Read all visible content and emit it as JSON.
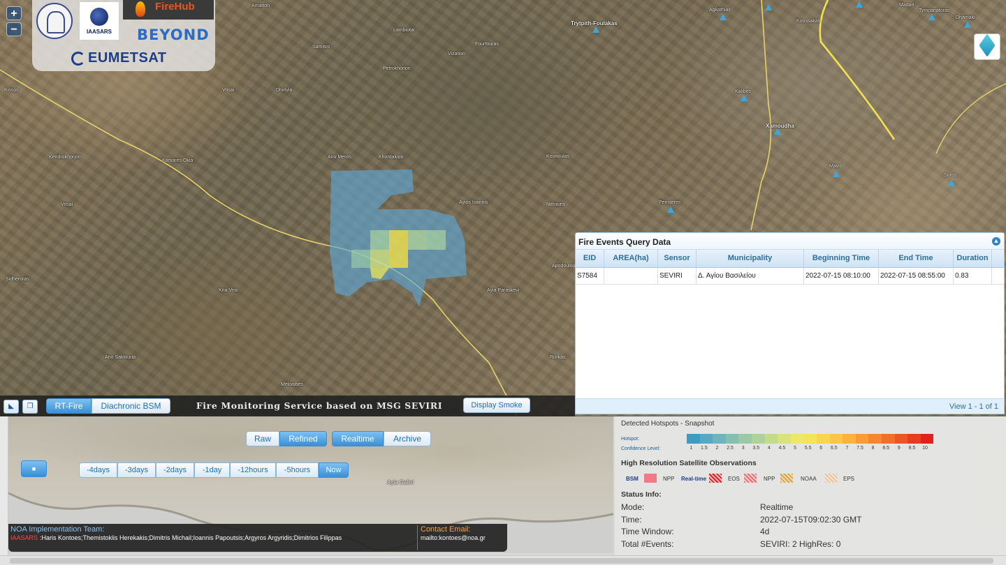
{
  "map": {
    "zoom_in": "+",
    "zoom_out": "−",
    "places": [
      {
        "name": "Amarion"
      },
      {
        "name": "Kissos"
      },
      {
        "name": "Vrisai"
      },
      {
        "name": "Dhiriyia"
      },
      {
        "name": "Lambiotai"
      },
      {
        "name": "Samitos"
      },
      {
        "name": "Vizarion"
      },
      {
        "name": "Fourfouras"
      },
      {
        "name": "Petrokhorion"
      },
      {
        "name": "Trytpith-Foulakas"
      },
      {
        "name": "Agkathias"
      },
      {
        "name": "Koussakas"
      },
      {
        "name": "Madari"
      },
      {
        "name": "Tympanatoras"
      },
      {
        "name": "Dhamaki"
      },
      {
        "name": "Kendrokhorion"
      },
      {
        "name": "Kalibes"
      },
      {
        "name": "Xamoudha"
      },
      {
        "name": "Ano Meros"
      },
      {
        "name": "Khordakion"
      },
      {
        "name": "Kounoulas"
      },
      {
        "name": "Ayios Ioannis"
      },
      {
        "name": "Nithavris"
      },
      {
        "name": "Peristeres"
      },
      {
        "name": "Mavri"
      },
      {
        "name": "Soros"
      },
      {
        "name": "Vrisai"
      },
      {
        "name": "Sidheroras"
      },
      {
        "name": "Kria Vrisi"
      },
      {
        "name": "Apodoulou"
      },
      {
        "name": "Ayia Paraskevi"
      },
      {
        "name": "Ano Saktouria"
      },
      {
        "name": "Rizikas"
      },
      {
        "name": "Meloaibes"
      },
      {
        "name": "Kamares Okia"
      }
    ]
  },
  "logos": {
    "iaasars": "IAASARS",
    "firehub": "FireHub",
    "beyond": "BEYOND",
    "eumetsat": "EUMETSAT"
  },
  "toolbar": {
    "rt_fire": "RT-Fire",
    "diachronic": "Diachronic BSM",
    "service_title": "Fire Monitoring Service based on MSG SEVIRI",
    "display_smoke": "Display Smoke"
  },
  "grid": {
    "title": "Fire Events Query Data",
    "columns": [
      "EID",
      "AREA(ha)",
      "Sensor",
      "Municipality",
      "Beginning Time",
      "End Time",
      "Duration"
    ],
    "rows": [
      [
        "S7584",
        "",
        "SEVIRI",
        "Δ. Αγίου Βασιλείου",
        "2022-07-15 08:10:00",
        "2022-07-15 08:55:00",
        "0.83"
      ]
    ],
    "view_text": "View 1 - 1 of 1"
  },
  "controls": {
    "raw": "Raw",
    "refined": "Refined",
    "realtime": "Realtime",
    "archive": "Archive",
    "stop": "■",
    "steps": [
      "-4days",
      "-3days",
      "-2days",
      "-1day",
      "-12hours",
      "-5hours",
      "Now"
    ]
  },
  "lower_map": {
    "place": "Ayia Galini"
  },
  "team": {
    "title": "NOA Implementation Team:",
    "org": "IAASARS",
    "names": ":Haris Kontoes;Themistoklis Herekakis;Dimitris Michail;Ioannis Papoutsis;Argyros Argyridis;Dimitrios Filippas",
    "contact_title": "Contact Email:",
    "contact_email": "mailto:kontoes@noa.gr"
  },
  "info": {
    "snapshot_title": "Detected Hotspots - Snapshot",
    "hotspot_label": "Hotspot:",
    "confidence_label": "Confidence Level:",
    "confidence_ticks": [
      "1",
      "1.5",
      "2",
      "2.5",
      "3",
      "3.5",
      "4",
      "4.5",
      "5",
      "5.5",
      "6",
      "6.5",
      "7",
      "7.5",
      "8",
      "8.5",
      "9",
      "9.5",
      "10"
    ],
    "confidence_colors": [
      "#3d9bc4",
      "#57a8c2",
      "#6fb4bd",
      "#86bfb2",
      "#9bc9a5",
      "#aed29a",
      "#c4db8b",
      "#d9e37b",
      "#ebe86a",
      "#f5e35c",
      "#f9d551",
      "#fbc547",
      "#fbb23f",
      "#f99c38",
      "#f58632",
      "#f16f2c",
      "#ec5626",
      "#e63c20",
      "#e0221c"
    ],
    "hr_title": "High Resolution Satellite Observations",
    "legend": {
      "bsm": "BSM",
      "npp1": "NPP",
      "realtime": "Real-time",
      "eos": "EOS",
      "npp2": "NPP",
      "noaa": "NOAA",
      "eps": "EPS"
    },
    "status_title": "Status Info:",
    "status": [
      {
        "k": "Mode:",
        "v": "Realtime"
      },
      {
        "k": "Time:",
        "v": "2022-07-15T09:02:30 GMT"
      },
      {
        "k": "Time Window:",
        "v": "4d"
      },
      {
        "k": "Total #Events:",
        "v": "SEVIRI: 2  HighRes: 0"
      }
    ]
  }
}
